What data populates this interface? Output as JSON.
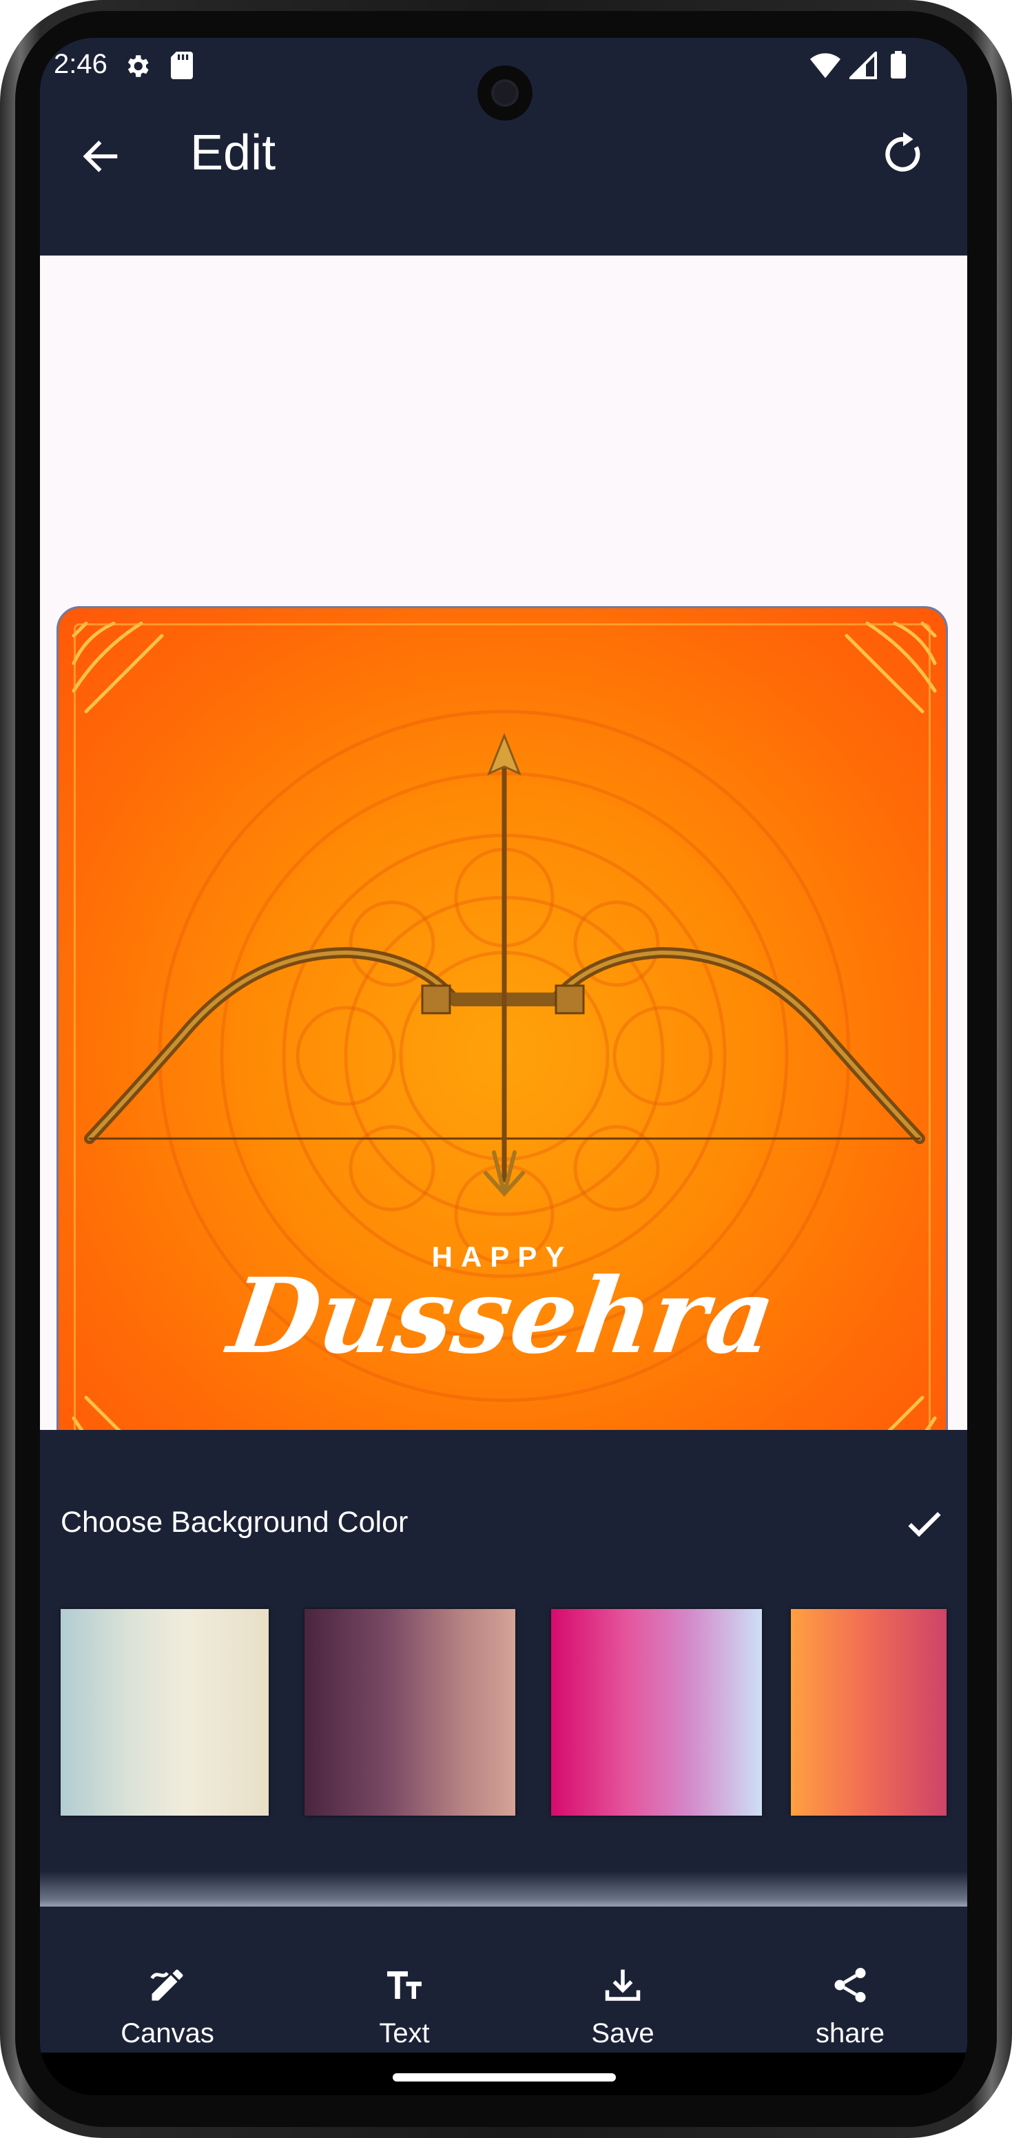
{
  "status_bar": {
    "time": "2:46"
  },
  "app_bar": {
    "title": "Edit"
  },
  "poster": {
    "line1": "HAPPY",
    "line2": "Dussehra"
  },
  "color_panel": {
    "title": "Choose Background Color",
    "swatches": [
      {
        "name": "pale-blue-cream",
        "colors": [
          "#b2cdd2",
          "#f0ecdc"
        ]
      },
      {
        "name": "plum-rose",
        "colors": [
          "#4a2540",
          "#d5a396"
        ]
      },
      {
        "name": "magenta-lavender",
        "colors": [
          "#d60b6d",
          "#cddff5"
        ]
      },
      {
        "name": "orange-pink",
        "colors": [
          "#ff9f41",
          "#cd4468"
        ]
      }
    ]
  },
  "bottom_nav": {
    "items": [
      {
        "label": "Canvas",
        "icon": "canvas-icon"
      },
      {
        "label": "Text",
        "icon": "text-size-icon"
      },
      {
        "label": "Save",
        "icon": "download-icon"
      },
      {
        "label": "share",
        "icon": "share-icon"
      }
    ]
  },
  "colors": {
    "header": "#1c2236",
    "canvas_bg": "#fcf8fb",
    "accent": "#ff6a07"
  }
}
